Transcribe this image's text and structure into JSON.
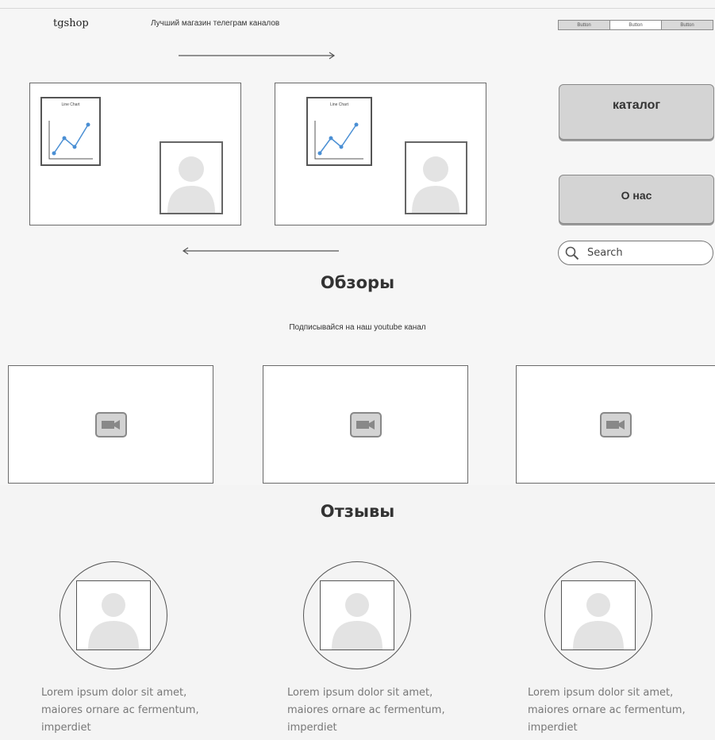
{
  "header": {
    "brand": "tgshop",
    "tagline": "Лучший магазин телеграм каналов",
    "button_group": [
      "Button",
      "Button",
      "Button"
    ]
  },
  "carousel": {
    "cards": [
      {
        "chart_title": "Line Chart"
      },
      {
        "chart_title": "Line Chart"
      }
    ]
  },
  "side_buttons": {
    "catalog_label": "каталог",
    "about_label": "О нас"
  },
  "search": {
    "placeholder": "Search"
  },
  "reviews_section": {
    "title": "Обзоры",
    "subtitle": "Подписывайся на наш youtube канал"
  },
  "testimonials_section": {
    "title": "Отзывы",
    "items": [
      {
        "text": "Lorem ipsum dolor sit amet, maiores ornare ac fermentum, imperdiet"
      },
      {
        "text": "Lorem ipsum dolor sit amet, maiores ornare ac fermentum, imperdiet"
      },
      {
        "text": "Lorem ipsum dolor sit amet, maiores ornare ac fermentum, imperdiet"
      }
    ]
  },
  "colors": {
    "background": "#f6f6f6",
    "button_fill": "#d4d4d4",
    "line_chart_stroke": "#4a8fd4",
    "placeholder_gray": "#e3e3e3"
  },
  "icons": [
    "search-icon",
    "video-icon",
    "arrow-right-icon",
    "arrow-left-icon",
    "user-placeholder-icon",
    "line-chart-icon"
  ]
}
